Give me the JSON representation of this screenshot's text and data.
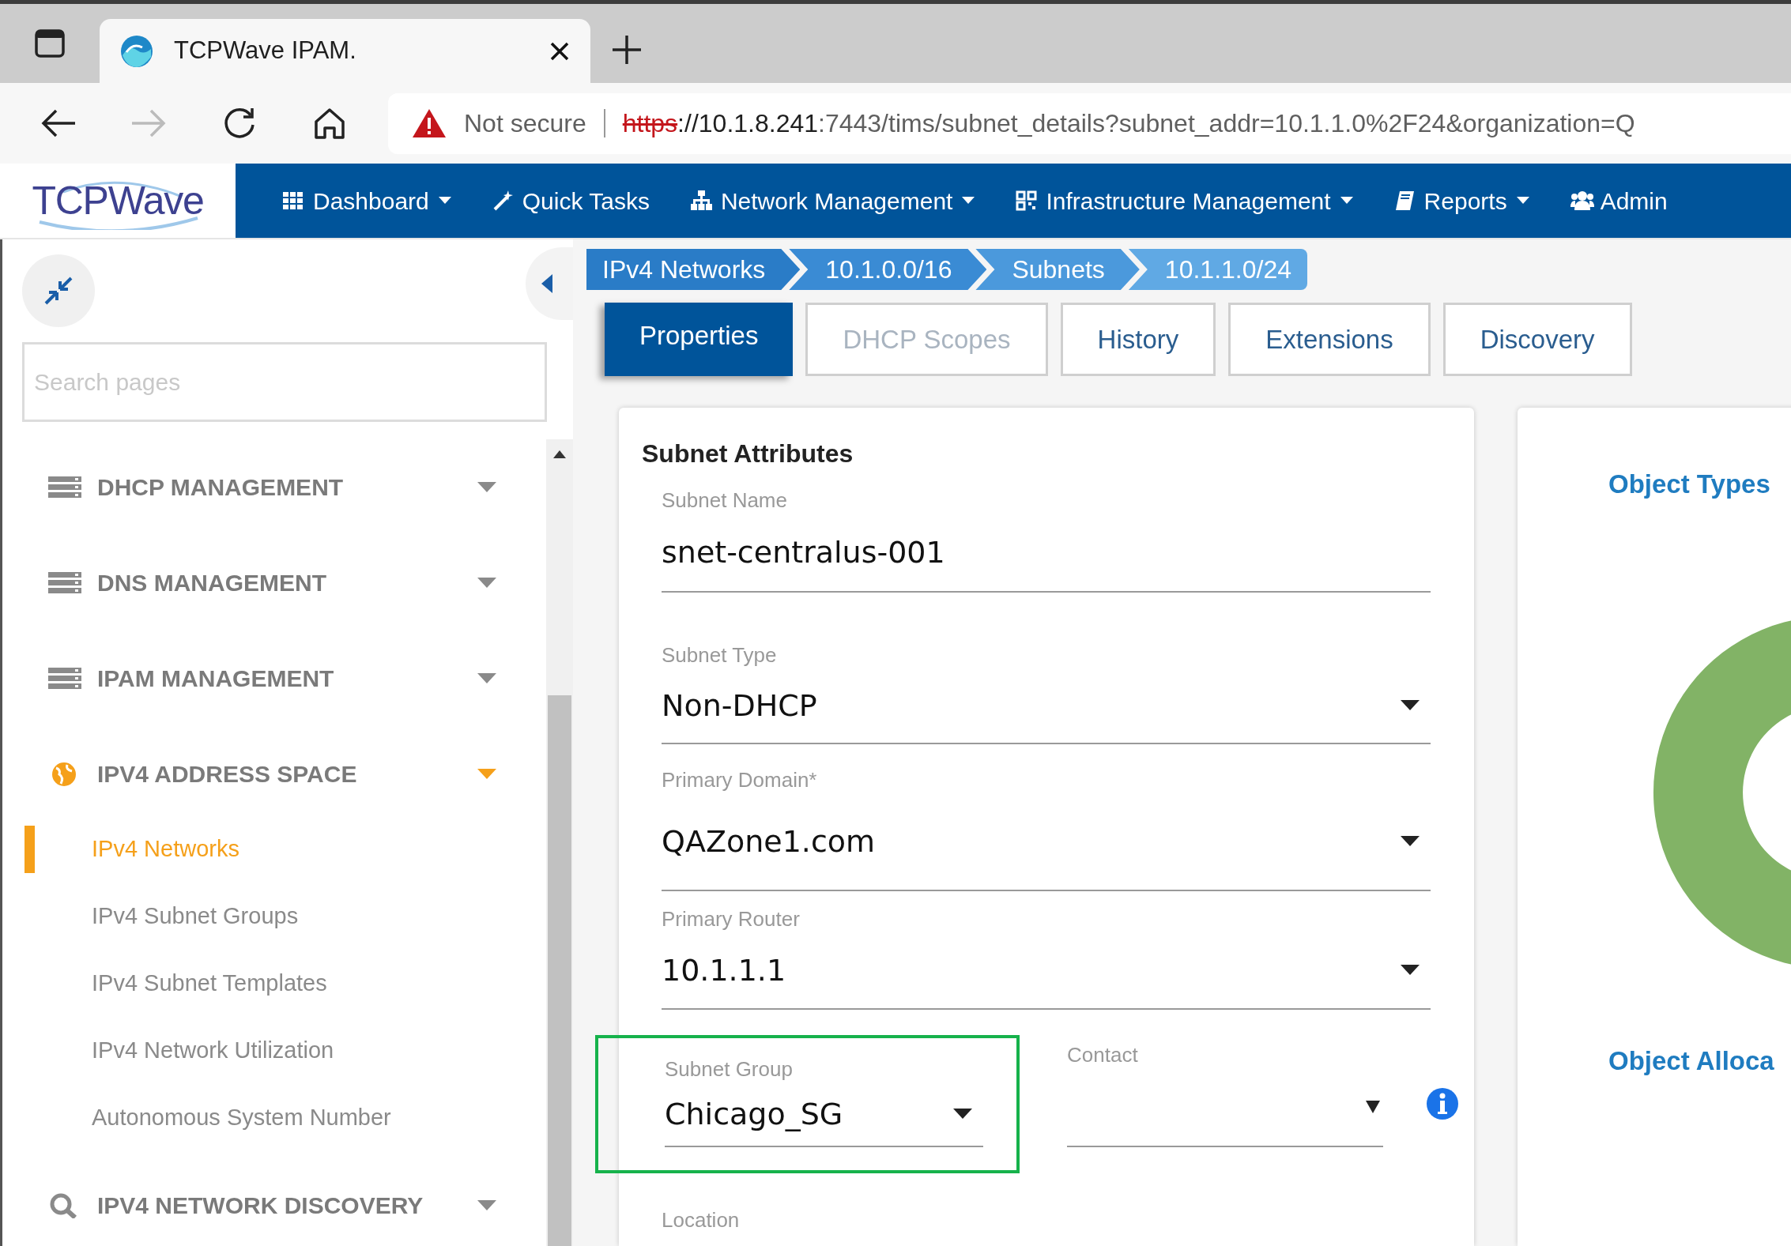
{
  "browser": {
    "tab_title": "TCPWave IPAM.",
    "security_label": "Not secure",
    "url_scheme": "https",
    "url_host": "://10.1.8.241",
    "url_rest": ":7443/tims/subnet_details?subnet_addr=10.1.1.0%2F24&organization=Q"
  },
  "app_nav": {
    "logo": "TCPWave",
    "menus": [
      {
        "label": "Dashboard",
        "kind": "grid",
        "dropdown": true
      },
      {
        "label": "Quick Tasks",
        "kind": "wand",
        "dropdown": false
      },
      {
        "label": "Network Management",
        "kind": "sitemap",
        "dropdown": true
      },
      {
        "label": "Infrastructure Management",
        "kind": "qr",
        "dropdown": true
      },
      {
        "label": "Reports",
        "kind": "book",
        "dropdown": true
      },
      {
        "label": "Admin",
        "kind": "users",
        "dropdown": false
      }
    ]
  },
  "sidebar": {
    "search_placeholder": "Search pages",
    "sections": [
      {
        "label": "DHCP MANAGEMENT",
        "kind": "server",
        "expanded": false
      },
      {
        "label": "DNS MANAGEMENT",
        "kind": "server",
        "expanded": false
      },
      {
        "label": "IPAM MANAGEMENT",
        "kind": "server",
        "expanded": false
      },
      {
        "label": "IPV4 ADDRESS SPACE",
        "kind": "globe",
        "expanded": true,
        "children": [
          {
            "label": "IPv4 Networks",
            "selected": true
          },
          {
            "label": "IPv4 Subnet Groups",
            "selected": false
          },
          {
            "label": "IPv4 Subnet Templates",
            "selected": false
          },
          {
            "label": "IPv4 Network Utilization",
            "selected": false
          },
          {
            "label": "Autonomous System Number",
            "selected": false
          }
        ]
      },
      {
        "label": "IPV4 NETWORK DISCOVERY",
        "kind": "search",
        "expanded": false
      }
    ]
  },
  "breadcrumb": [
    "IPv4 Networks",
    "10.1.0.0/16",
    "Subnets",
    "10.1.1.0/24"
  ],
  "tabs": [
    {
      "label": "Properties",
      "selected": true,
      "disabled": false
    },
    {
      "label": "DHCP Scopes",
      "selected": false,
      "disabled": true
    },
    {
      "label": "History",
      "selected": false,
      "disabled": false
    },
    {
      "label": "Extensions",
      "selected": false,
      "disabled": false
    },
    {
      "label": "Discovery",
      "selected": false,
      "disabled": false
    }
  ],
  "subnet_attributes": {
    "title": "Subnet Attributes",
    "fields": [
      {
        "label": "Subnet Name",
        "value": "snet-centralus-001",
        "kind": "text"
      },
      {
        "label": "Subnet Type",
        "value": "Non-DHCP",
        "kind": "select"
      },
      {
        "label": "Primary Domain*",
        "value": "QAZone1.com",
        "kind": "select"
      },
      {
        "label": "Primary Router",
        "value": "10.1.1.1",
        "kind": "select"
      }
    ],
    "subnet_group": {
      "label": "Subnet Group",
      "value": "Chicago_SG",
      "highlighted": true
    },
    "contact": {
      "label": "Contact"
    },
    "location_label": "Location"
  },
  "object_panel": {
    "title": "Object Types",
    "footer_title": "Object Alloca"
  }
}
